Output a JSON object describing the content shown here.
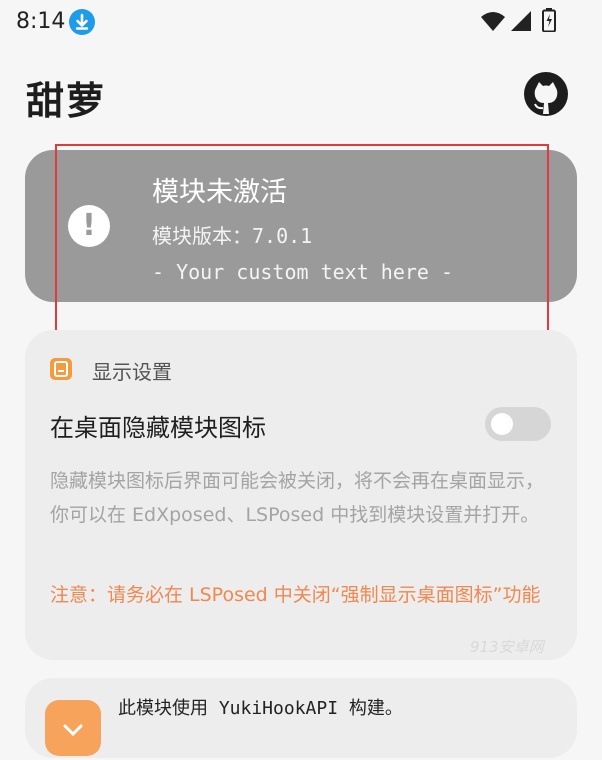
{
  "status_bar": {
    "time": "8:14",
    "icons": [
      "download-icon",
      "wifi-icon",
      "signal-icon",
      "battery-icon"
    ]
  },
  "header": {
    "title": "甜萝",
    "github_icon": "github-icon"
  },
  "module_status": {
    "icon": "exclamation-icon",
    "title": "模块未激活",
    "version": "模块版本：7.0.1",
    "custom_text": "- Your custom text here -"
  },
  "display_settings": {
    "section_icon": "display-settings-icon",
    "section_label": "显示设置",
    "hide_icon_label": "在桌面隐藏模块图标",
    "hide_icon_enabled": false,
    "description": "隐藏模块图标后界面可能会被关闭，将不会再在桌面显示，你可以在 EdXposed、LSPosed 中找到模块设置并打开。",
    "warning": "注意：请务必在 LSPosed 中关闭“强制显示桌面图标”功能"
  },
  "watermark": "913安卓网",
  "footer": {
    "icon": "yuki-hook-icon",
    "text": "此模块使用 YukiHookAPI 构建。"
  },
  "colors": {
    "background": "#f6f6f6",
    "status_card": "#9a9a9a",
    "card": "#ededed",
    "accent_orange": "#f08850",
    "download_blue": "#1e9be9"
  }
}
